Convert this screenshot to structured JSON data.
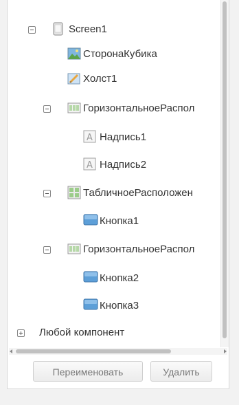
{
  "tree": {
    "items": [
      {
        "label": "Screen1",
        "icon": "screen-icon",
        "toggle": "expanded"
      },
      {
        "label": "СторонаКубика",
        "icon": "image-icon"
      },
      {
        "label": "Холст1",
        "icon": "canvas-icon"
      },
      {
        "label": "ГоризонтальноеРаспол",
        "icon": "horizontal-arrangement-icon",
        "toggle": "expanded"
      },
      {
        "label": "Надпись1",
        "icon": "label-icon"
      },
      {
        "label": "Надпись2",
        "icon": "label-icon"
      },
      {
        "label": "ТабличноеРасположен",
        "icon": "table-arrangement-icon",
        "toggle": "expanded"
      },
      {
        "label": "Кнопка1",
        "icon": "button-icon"
      },
      {
        "label": "ГоризонтальноеРаспол",
        "icon": "horizontal-arrangement-icon",
        "toggle": "expanded"
      },
      {
        "label": "Кнопка2",
        "icon": "button-icon"
      },
      {
        "label": "Кнопка3",
        "icon": "button-icon"
      }
    ],
    "any_component": {
      "label": "Любой компонент",
      "toggle": "collapsed"
    }
  },
  "buttons": {
    "rename": "Переименовать",
    "delete": "Удалить"
  }
}
